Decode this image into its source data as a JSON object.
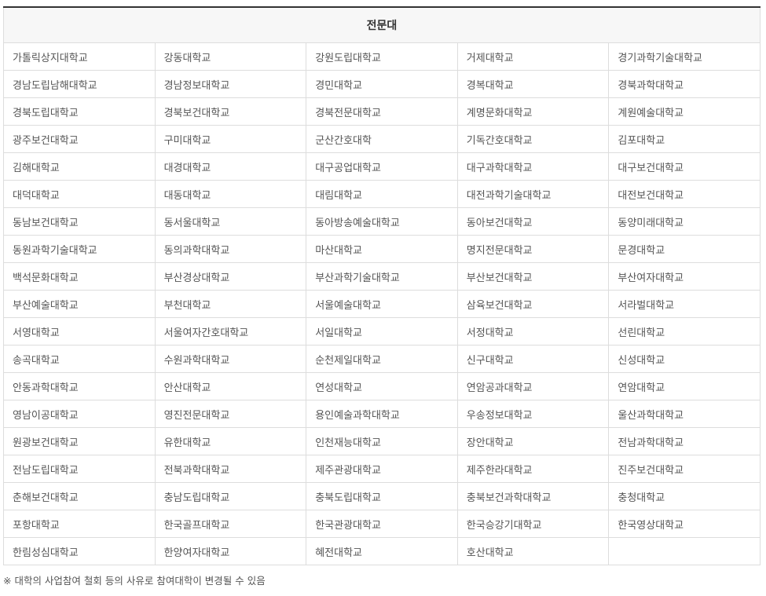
{
  "table": {
    "header": "전문대",
    "rows": [
      [
        "가톨릭상지대학교",
        "강동대학교",
        "강원도립대학교",
        "거제대학교",
        "경기과학기술대학교"
      ],
      [
        "경남도립남해대학교",
        "경남정보대학교",
        "경민대학교",
        "경복대학교",
        "경북과학대학교"
      ],
      [
        "경북도립대학교",
        "경북보건대학교",
        "경북전문대학교",
        "계명문화대학교",
        "계원예술대학교"
      ],
      [
        "광주보건대학교",
        "구미대학교",
        "군산간호대학",
        "기독간호대학교",
        "김포대학교"
      ],
      [
        "김해대학교",
        "대경대학교",
        "대구공업대학교",
        "대구과학대학교",
        "대구보건대학교"
      ],
      [
        "대덕대학교",
        "대동대학교",
        "대림대학교",
        "대전과학기술대학교",
        "대전보건대학교"
      ],
      [
        "동남보건대학교",
        "동서울대학교",
        "동아방송예술대학교",
        "동아보건대학교",
        "동양미래대학교"
      ],
      [
        "동원과학기술대학교",
        "동의과학대학교",
        "마산대학교",
        "명지전문대학교",
        "문경대학교"
      ],
      [
        "백석문화대학교",
        "부산경상대학교",
        "부산과학기술대학교",
        "부산보건대학교",
        "부산여자대학교"
      ],
      [
        "부산예술대학교",
        "부천대학교",
        "서울예술대학교",
        "삼육보건대학교",
        "서라벌대학교"
      ],
      [
        "서영대학교",
        "서울여자간호대학교",
        "서일대학교",
        "서정대학교",
        "선린대학교"
      ],
      [
        "송곡대학교",
        "수원과학대학교",
        "순천제일대학교",
        "신구대학교",
        "신성대학교"
      ],
      [
        "안동과학대학교",
        "안산대학교",
        "연성대학교",
        "연암공과대학교",
        "연암대학교"
      ],
      [
        "영남이공대학교",
        "영진전문대학교",
        "용인예술과학대학교",
        "우송정보대학교",
        "울산과학대학교"
      ],
      [
        "원광보건대학교",
        "유한대학교",
        "인천재능대학교",
        "장안대학교",
        "전남과학대학교"
      ],
      [
        "전남도립대학교",
        "전북과학대학교",
        "제주관광대학교",
        "제주한라대학교",
        "진주보건대학교"
      ],
      [
        "춘해보건대학교",
        "충남도립대학교",
        "충북도립대학교",
        "충북보건과학대학교",
        "충청대학교"
      ],
      [
        "포항대학교",
        "한국골프대학교",
        "한국관광대학교",
        "한국승강기대학교",
        "한국영상대학교"
      ],
      [
        "한림성심대학교",
        "한양여자대학교",
        "혜전대학교",
        "호산대학교",
        ""
      ]
    ]
  },
  "note": "※ 대학의 사업참여 철회 등의 사유로 참여대학이 변경될 수 있음"
}
